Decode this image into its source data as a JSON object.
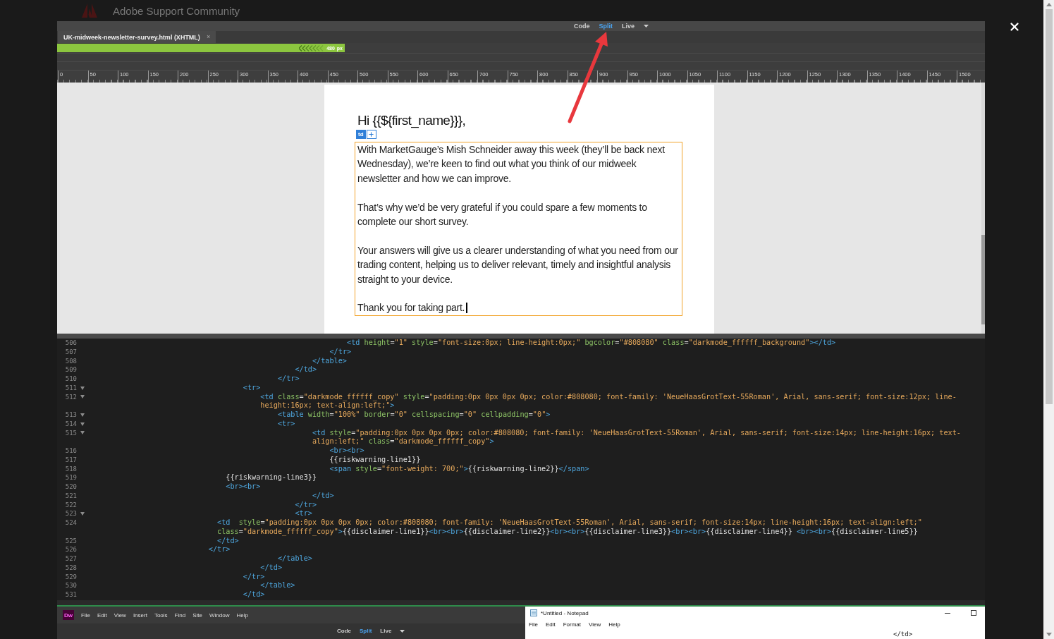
{
  "backdrop": {
    "site_title": "Adobe Support Community"
  },
  "view_switcher": [
    {
      "label": "Code",
      "selected": false,
      "dropdown": false
    },
    {
      "label": "Split",
      "selected": true,
      "dropdown": false
    },
    {
      "label": "Live",
      "selected": false,
      "dropdown": true
    }
  ],
  "document_tab": {
    "label": "UK-midweek-newsletter-survey.html (XHTML)",
    "close": "×"
  },
  "media_query_bar": {
    "label": "480",
    "unit": "px"
  },
  "ruler": [
    "0",
    "50",
    "100",
    "150",
    "200",
    "250",
    "300",
    "350",
    "400",
    "450",
    "500",
    "550",
    "600",
    "650",
    "700",
    "750",
    "800",
    "850",
    "900",
    "950",
    "1000",
    "1050",
    "1100",
    "1150",
    "1200",
    "1250",
    "1300",
    "1350",
    "1400",
    "1450",
    "1500"
  ],
  "design_view": {
    "greeting": "Hi {{${first_name}}},",
    "tag_badge": "td",
    "cursor_in_last_paragraph": true,
    "paragraphs": [
      "With MarketGauge’s Mish Schneider away this week (they’ll be back next Wednesday), we’re keen to find out what you think of our midweek newsletter and how we can improve.",
      "That’s why we’d be very grateful if you could spare a few moments to complete our short survey.",
      "Your answers will give us a clearer understanding of what you need from our trading content, helping us to deliver relevant, timely and insightful analysis straight to your device.",
      "Thank you for taking part."
    ]
  },
  "code_rows": [
    {
      "number": "506",
      "fold": false,
      "text": "                                                            <td height=\"1\" style=\"font-size:0px; line-height:0px;\" bgcolor=\"#808080\" class=\"darkmode_ffffff_background\"></td>"
    },
    {
      "number": "507",
      "fold": false,
      "text": "                                                        </tr>"
    },
    {
      "number": "508",
      "fold": false,
      "text": "                                                    </table>"
    },
    {
      "number": "509",
      "fold": false,
      "text": "                                                </td>"
    },
    {
      "number": "510",
      "fold": false,
      "text": "                                            </tr>"
    },
    {
      "number": "511",
      "fold": true,
      "text": "                                    <tr>"
    },
    {
      "number": "512",
      "fold": true,
      "text": "                                        <td class=\"darkmode_ffffff_copy\" style=\"padding:0px 0px 0px 0px; color:#808080; font-family: 'NeueHaasGrotText-55Roman', Arial, sans-serif; font-size:12px; line-"
    },
    {
      "text": "                                        height:16px; text-align:left;\">"
    },
    {
      "number": "513",
      "fold": true,
      "text": "                                            <table width=\"100%\" border=\"0\" cellspacing=\"0\" cellpadding=\"0\">"
    },
    {
      "number": "514",
      "fold": true,
      "text": "                                            <tr>"
    },
    {
      "number": "515",
      "fold": true,
      "text": "                                                    <td style=\"padding:0px 0px 0px 0px; color:#808080; font-family: 'NeueHaasGrotText-55Roman', Arial, sans-serif; font-size:14px; line-height:16px; text-"
    },
    {
      "text": "                                                    align:left;\" class=\"darkmode_ffffff_copy\">"
    },
    {
      "number": "516",
      "fold": false,
      "text": "                                                        <br><br>"
    },
    {
      "number": "517",
      "fold": false,
      "text": "                                                        {{riskwarning-line1}}"
    },
    {
      "number": "518",
      "fold": false,
      "text": "                                                        <span style=\"font-weight: 700;\">{{riskwarning-line2}}</span>"
    },
    {
      "number": "519",
      "fold": false,
      "text": "                                {{riskwarning-line3}}"
    },
    {
      "number": "520",
      "fold": false,
      "text": "                                <br><br>"
    },
    {
      "number": "521",
      "fold": false,
      "text": "                                                    </td>"
    },
    {
      "number": "522",
      "fold": false,
      "text": "                                                </tr>"
    },
    {
      "number": "523",
      "fold": true,
      "text": "                                                <tr>"
    },
    {
      "number": "524",
      "fold": false,
      "text": "                              <td  style=\"padding:0px 0px 0px 0px; color:#808080; font-family: 'NeueHaasGrotText-55Roman', Arial, sans-serif; font-size:14px; line-height:16px; text-align:left;\""
    },
    {
      "text": "                              class=\"darkmode_ffffff_copy\">{{disclaimer-line1}}<br><br>{{disclaimer-line2}}<br><br>{{disclaimer-line3}}<br><br>{{disclaimer-line4}} <br><br>{{disclaimer-line5}}"
    },
    {
      "number": "525",
      "fold": false,
      "text": "                              </td>"
    },
    {
      "number": "526",
      "fold": false,
      "text": "                            </tr>"
    },
    {
      "number": "527",
      "fold": false,
      "text": "                                            </table>"
    },
    {
      "number": "528",
      "fold": false,
      "text": "                                        </td>"
    },
    {
      "number": "529",
      "fold": false,
      "text": "                                    </tr>"
    },
    {
      "number": "530",
      "fold": false,
      "text": "                                        </table>"
    },
    {
      "number": "531",
      "fold": false,
      "text": "                                    </td>"
    }
  ],
  "bottom_window": {
    "app_icon": "Dw",
    "menu": [
      "File",
      "Edit",
      "View",
      "Insert",
      "Tools",
      "Find",
      "Site",
      "Window",
      "Help"
    ],
    "view_switcher": [
      {
        "label": "Code",
        "selected": false,
        "dropdown": false
      },
      {
        "label": "Split",
        "selected": true,
        "dropdown": false
      },
      {
        "label": "Live",
        "selected": false,
        "dropdown": true
      }
    ]
  },
  "notepad": {
    "title": "*Untitled - Notepad",
    "menu": [
      "File",
      "Edit",
      "Format",
      "View",
      "Help"
    ],
    "content": "</td>"
  }
}
